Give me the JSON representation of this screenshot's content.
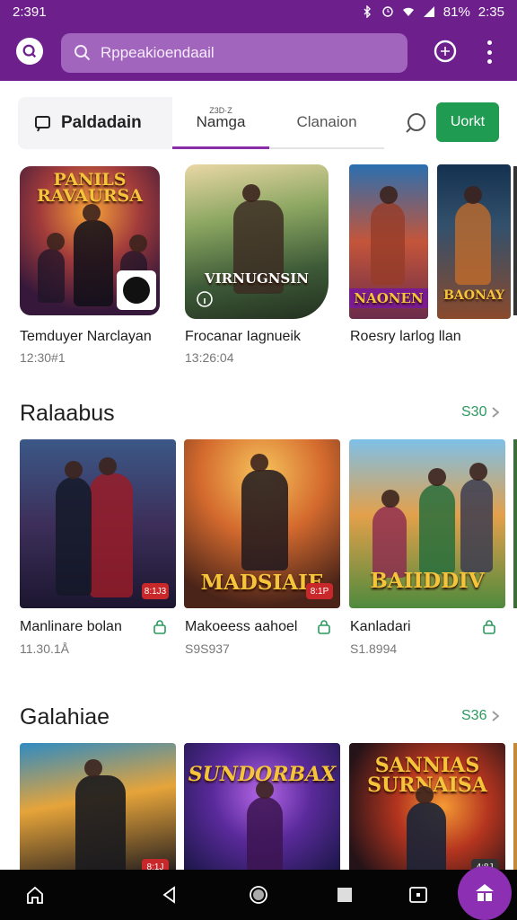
{
  "status": {
    "time": "2:391",
    "right": "81%",
    "clock": "2:35"
  },
  "search": {
    "placeholder": "Rppeakioendaail"
  },
  "tabs": {
    "library": "Paldadain",
    "name_small": "Z3D·Z",
    "name": "Namga",
    "category": "Clanaion",
    "action": "Uorkt"
  },
  "colors": {
    "brand": "#6d1f8c",
    "accent": "#1f9b52",
    "fab": "#8c2fb3"
  },
  "featured": [
    {
      "title": "Temduyer Narclayan",
      "sub": "12:30#1",
      "art_text": "PANILS\nRAVAURSA",
      "icon": "fist-icon"
    },
    {
      "title": "Frocanar Iagnueik",
      "sub": "13:26:04",
      "art_text": "VIRNUGNSIN",
      "icon": "info-icon"
    },
    {
      "title": "Roesry larlog llan",
      "sub": "",
      "art_text": "NAONEN",
      "icon": ""
    },
    {
      "title": "",
      "sub": "",
      "art_text": "BAONAY",
      "icon": ""
    }
  ],
  "section1": {
    "title": "Ralaabus",
    "see_all": "S30"
  },
  "row1": [
    {
      "title": "Manlinare bolan",
      "sub": "11.30.1Å",
      "art_text": "",
      "badge": "8:1J3"
    },
    {
      "title": "Makoeess aahoel",
      "sub": "S9S937",
      "art_text": "MADSIAIE",
      "badge": "8:1P"
    },
    {
      "title": "Kanladari",
      "sub": "S1.8994",
      "art_text": "BAIIDDIV",
      "badge": ""
    }
  ],
  "section2": {
    "title": "Galahiae",
    "see_all": "S36"
  },
  "row2": [
    {
      "art_text": "",
      "badge": "8:1J"
    },
    {
      "art_text": "SUNDORBAX",
      "badge": ""
    },
    {
      "art_text": "SANNIAS\nSURNAISA",
      "badge": "4:8J"
    }
  ],
  "navbar": {
    "items": [
      "home-icon",
      "back-icon",
      "home-circle-icon",
      "recents-icon",
      "screen-icon"
    ]
  }
}
